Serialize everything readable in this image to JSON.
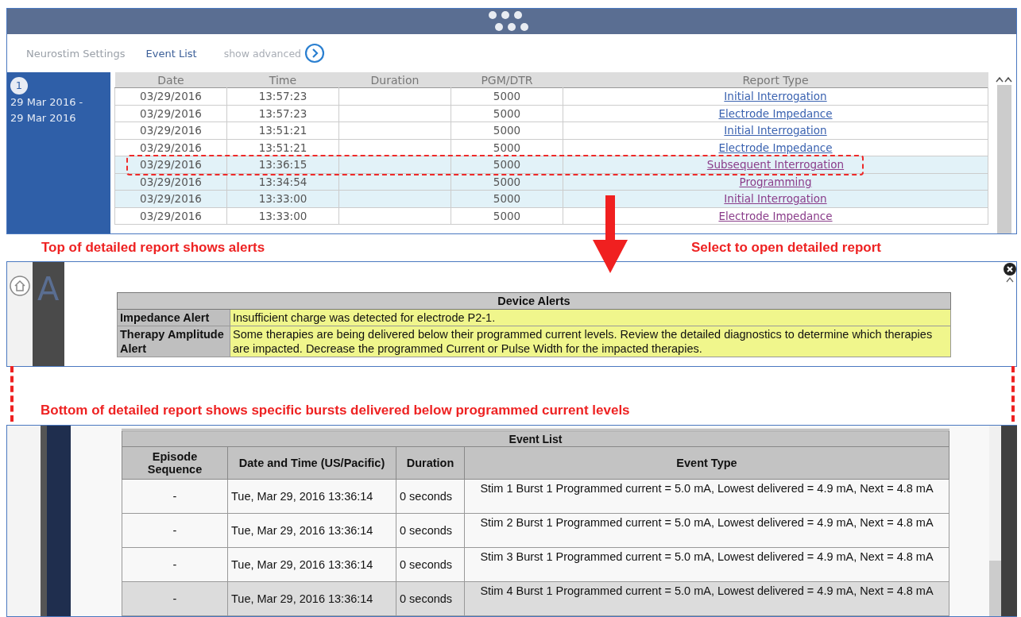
{
  "event_screen": {
    "tabs": [
      {
        "label": "Neurostim Settings",
        "selected": false
      },
      {
        "label": "Event List",
        "selected": true
      }
    ],
    "show_advanced": "show advanced",
    "sidebar": {
      "badge": "1",
      "date_range": "29 Mar 2016 - 29 Mar 2016"
    },
    "table": {
      "columns": [
        "Date",
        "Time",
        "Duration",
        "PGM/DTR",
        "Report Type"
      ],
      "rows": [
        {
          "date": "03/29/2016",
          "time": "13:57:23",
          "pgm": "5000",
          "report_type": "Initial Interrogation",
          "selected": false,
          "visited": false,
          "callout": false
        },
        {
          "date": "03/29/2016",
          "time": "13:57:23",
          "pgm": "5000",
          "report_type": "Electrode Impedance",
          "selected": false,
          "visited": false,
          "callout": false
        },
        {
          "date": "03/29/2016",
          "time": "13:51:21",
          "pgm": "5000",
          "report_type": "Initial Interrogation",
          "selected": false,
          "visited": false,
          "callout": false
        },
        {
          "date": "03/29/2016",
          "time": "13:51:21",
          "pgm": "5000",
          "report_type": "Electrode Impedance",
          "selected": false,
          "visited": false,
          "callout": false
        },
        {
          "date": "03/29/2016",
          "time": "13:36:15",
          "pgm": "5000",
          "report_type": "Subsequent Interrogation",
          "selected": true,
          "visited": true,
          "callout": true
        },
        {
          "date": "03/29/2016",
          "time": "13:34:54",
          "pgm": "5000",
          "report_type": "Programming",
          "selected": true,
          "visited": true,
          "callout": false
        },
        {
          "date": "03/29/2016",
          "time": "13:33:00",
          "pgm": "5000",
          "report_type": "Initial Interrogation",
          "selected": true,
          "visited": true,
          "callout": false
        },
        {
          "date": "03/29/2016",
          "time": "13:33:00",
          "pgm": "5000",
          "report_type": "Electrode Impedance",
          "selected": false,
          "visited": true,
          "callout": false
        }
      ]
    }
  },
  "annotations": {
    "top_left": "Top of detailed report shows alerts",
    "top_right": "Select to open detailed report",
    "middle": "Bottom of detailed report shows specific bursts delivered below programmed current levels"
  },
  "alerts_screen": {
    "background_letter": "A",
    "title": "Device Alerts",
    "rows": [
      {
        "label": "Impedance Alert",
        "text": "Insufficient charge was detected for electrode P2-1."
      },
      {
        "label": "Therapy Amplitude Alert",
        "text": "Some therapies are being delivered below their programmed current levels. Review the detailed diagnostics to determine which therapies are impacted. Decrease the programmed Current or Pulse Width for the impacted therapies."
      }
    ]
  },
  "event_list_screen": {
    "title": "Event List",
    "columns": [
      "Episode Sequence",
      "Date and Time (US/Pacific)",
      "Duration",
      "Event Type"
    ],
    "rows": [
      {
        "sequence": "-",
        "datetime": "Tue, Mar 29, 2016 13:36:14",
        "duration": "0 seconds",
        "event_type": "Stim 1 Burst 1 Programmed current = 5.0 mA, Lowest delivered = 4.9 mA, Next = 4.8 mA",
        "shaded": false
      },
      {
        "sequence": "-",
        "datetime": "Tue, Mar 29, 2016 13:36:14",
        "duration": "0 seconds",
        "event_type": "Stim 2 Burst 1 Programmed current = 5.0 mA, Lowest delivered = 4.9 mA, Next = 4.8 mA",
        "shaded": false
      },
      {
        "sequence": "-",
        "datetime": "Tue, Mar 29, 2016 13:36:14",
        "duration": "0 seconds",
        "event_type": "Stim 3 Burst 1 Programmed current = 5.0 mA, Lowest delivered = 4.9 mA, Next = 4.8 mA",
        "shaded": false
      },
      {
        "sequence": "-",
        "datetime": "Tue, Mar 29, 2016 13:36:14",
        "duration": "0 seconds",
        "event_type": "Stim 4 Burst 1 Programmed current = 5.0 mA, Lowest delivered = 4.9 mA, Next = 4.8 mA",
        "shaded": true
      }
    ]
  }
}
